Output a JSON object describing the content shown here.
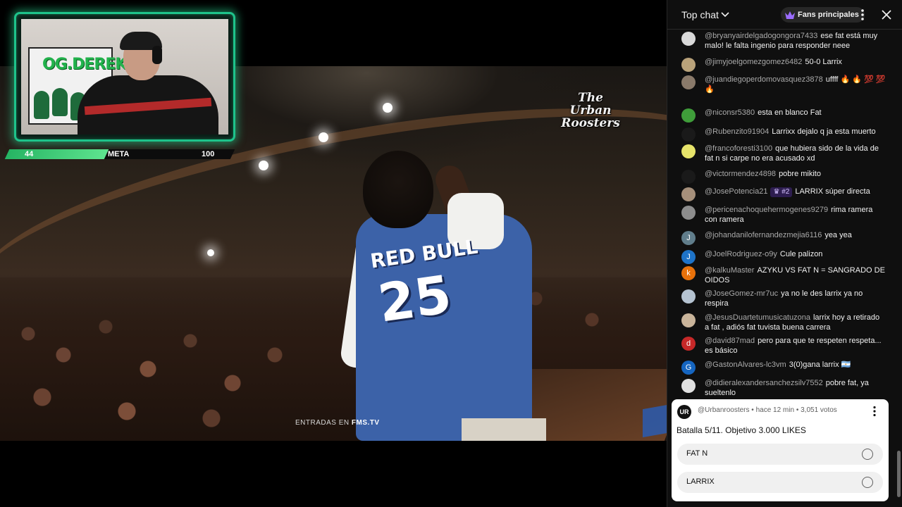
{
  "overlay": {
    "meta_current": "44",
    "meta_label": "META",
    "meta_goal": "100",
    "meta_progress": 0.44,
    "poster_text": "OG.DEREK"
  },
  "video": {
    "watermark": "The Urban Roosters",
    "jersey_text": "RED BULL",
    "jersey_number": "25",
    "url_prefix": "ENTRADAS EN",
    "url_site": "FMS.TV"
  },
  "chat": {
    "title": "Top chat",
    "fans_button": "Fans principales",
    "messages": [
      {
        "author": "@bryanyairdelgadogongora7433",
        "text": "ese fat está muy malo! le falta ingenio para responder neee",
        "avatar": "",
        "avatar_color": "#d9d9d9"
      },
      {
        "author": "@jimyjoelgomezgomez6482",
        "text": "50-0 Larrix",
        "avatar": "",
        "avatar_color": "#b9a27a"
      },
      {
        "author": "@juandiegoperdomovasquez3878",
        "text": "uffff 🔥 🔥 💯 💯 🔥",
        "avatar": "",
        "avatar_color": "#8a7a6a"
      },
      {
        "author": "@niconsr5380",
        "text": "esta en blanco Fat",
        "avatar": "",
        "avatar_color": "#3f9d3a"
      },
      {
        "author": "@Rubenzito91904",
        "text": "Larrixx dejalo q ja esta muerto",
        "avatar": "",
        "avatar_color": "#1a1a1a"
      },
      {
        "author": "@francoforesti3100",
        "text": "que hubiera sido de la vida de fat n si carpe no era acusado xd",
        "avatar": "",
        "avatar_color": "#e6e36a"
      },
      {
        "author": "@victormendez4898",
        "text": "pobre mikito",
        "avatar": "",
        "avatar_color": "#1a1a1a"
      },
      {
        "author": "@JosePotencia21",
        "badge": "#2",
        "text": "LARRIX súper directa",
        "avatar": "",
        "avatar_color": "#a58f7a"
      },
      {
        "author": "@pericenachoquehermogenes9279",
        "text": "rima ramera con ramera",
        "avatar": "",
        "avatar_color": "#8d8d8d"
      },
      {
        "author": "@johandanilofernandezmejia6116",
        "text": "yea yea",
        "avatar": "J",
        "avatar_color": "#607d8b"
      },
      {
        "author": "@JoelRodriguez-o9y",
        "text": "Cule palizon",
        "avatar": "J",
        "avatar_color": "#1e73c8"
      },
      {
        "author": "@kalkuMaster",
        "text": "AZYKU VS FAT N = SANGRADO DE OIDOS",
        "avatar": "k",
        "avatar_color": "#e8710a"
      },
      {
        "author": "@JoseGomez-mr7uc",
        "text": "ya no le des larrix ya no respira",
        "avatar": "",
        "avatar_color": "#b5c3d1"
      },
      {
        "author": "@JesusDuartetumusicatuzona",
        "text": "larrix hoy a retirado a fat , adiós fat tuvista buena carrera",
        "avatar": "",
        "avatar_color": "#c9b49a"
      },
      {
        "author": "@david87mad",
        "text": "pero para que te respeten respeta... es básico",
        "avatar": "d",
        "avatar_color": "#c62828"
      },
      {
        "author": "@GastonAlvares-lc3vm",
        "text": "3(0)gana larrix 🇦🇷",
        "avatar": "G",
        "avatar_color": "#1565c0"
      },
      {
        "author": "@didieralexandersanchezsilv7552",
        "text": "pobre fat, ya sueltenlo",
        "avatar": "",
        "avatar_color": "#e0e0e0"
      }
    ],
    "poll": {
      "avatar": "UR",
      "meta": "@Urbanroosters • hace 12 min • 3,051 votos",
      "question": "Batalla 5/11. Objetivo 3.000 LIKES",
      "options": [
        "FAT N",
        "LARRIX"
      ]
    }
  }
}
